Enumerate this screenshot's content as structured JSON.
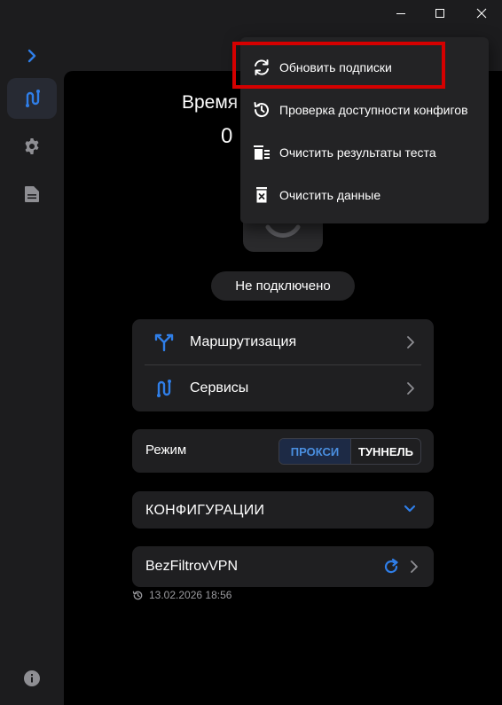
{
  "colors": {
    "accent": "#2f7ee8",
    "highlight_box": "#d50000",
    "background": "#1c1c1e",
    "content": "#000000"
  },
  "window_controls": {
    "icons": [
      "minimize-icon",
      "maximize-icon",
      "close-icon"
    ]
  },
  "rail": {
    "items": [
      {
        "icon": "chevron-right-icon"
      },
      {
        "icon": "routes-icon",
        "active": true
      },
      {
        "icon": "gear-icon"
      },
      {
        "icon": "document-icon"
      },
      {
        "icon": "info-icon"
      }
    ]
  },
  "main": {
    "time_label": "Время",
    "time_value": "0",
    "status": "Не подключено",
    "nav_card": [
      {
        "label": "Маршрутизация",
        "icon": "routing-icon"
      },
      {
        "label": "Сервисы",
        "icon": "services-icon"
      }
    ],
    "mode": {
      "label": "Режим",
      "options": [
        "ПРОКСИ",
        "ТУННЕЛЬ"
      ],
      "selected": "ПРОКСИ"
    },
    "configs": {
      "title": "КОНФИГУРАЦИИ"
    },
    "subscription": {
      "name": "BezFiltrovVPN",
      "updated": "13.02.2026 18:56"
    }
  },
  "context_menu": {
    "items": [
      {
        "label": "Обновить подписки",
        "icon": "refresh-icon"
      },
      {
        "label": "Проверка доступности конфигов",
        "icon": "check-availability-icon"
      },
      {
        "label": "Очистить результаты теста",
        "icon": "clear-list-icon"
      },
      {
        "label": "Очистить данные",
        "icon": "trash-icon"
      }
    ]
  }
}
